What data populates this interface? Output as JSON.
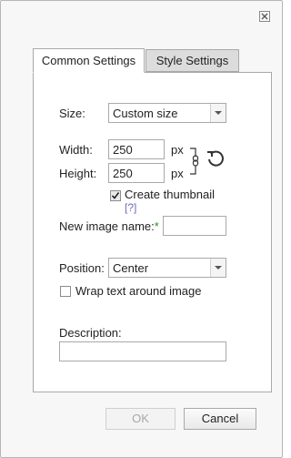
{
  "dialog": {
    "close_icon": "close-icon"
  },
  "tabs": [
    {
      "label": "Common Settings",
      "active": true
    },
    {
      "label": "Style Settings",
      "active": false
    }
  ],
  "form": {
    "size_label": "Size:",
    "size_value": "Custom size",
    "width_label": "Width:",
    "width_value": "250",
    "width_unit": "px",
    "height_label": "Height:",
    "height_value": "250",
    "height_unit": "px",
    "create_thumbnail_label": "Create thumbnail",
    "create_thumbnail_checked": true,
    "help_link": "[?]",
    "new_image_name_label": "New image name:",
    "required_marker": "*",
    "new_image_name_value": "",
    "position_label": "Position:",
    "position_value": "Center",
    "wrap_text_label": "Wrap text around image",
    "wrap_text_checked": false,
    "description_label": "Description:",
    "description_value": ""
  },
  "buttons": {
    "ok_label": "OK",
    "cancel_label": "Cancel"
  },
  "colors": {
    "required": "#2e8b2e",
    "disabled_text": "#a8a8a8"
  }
}
